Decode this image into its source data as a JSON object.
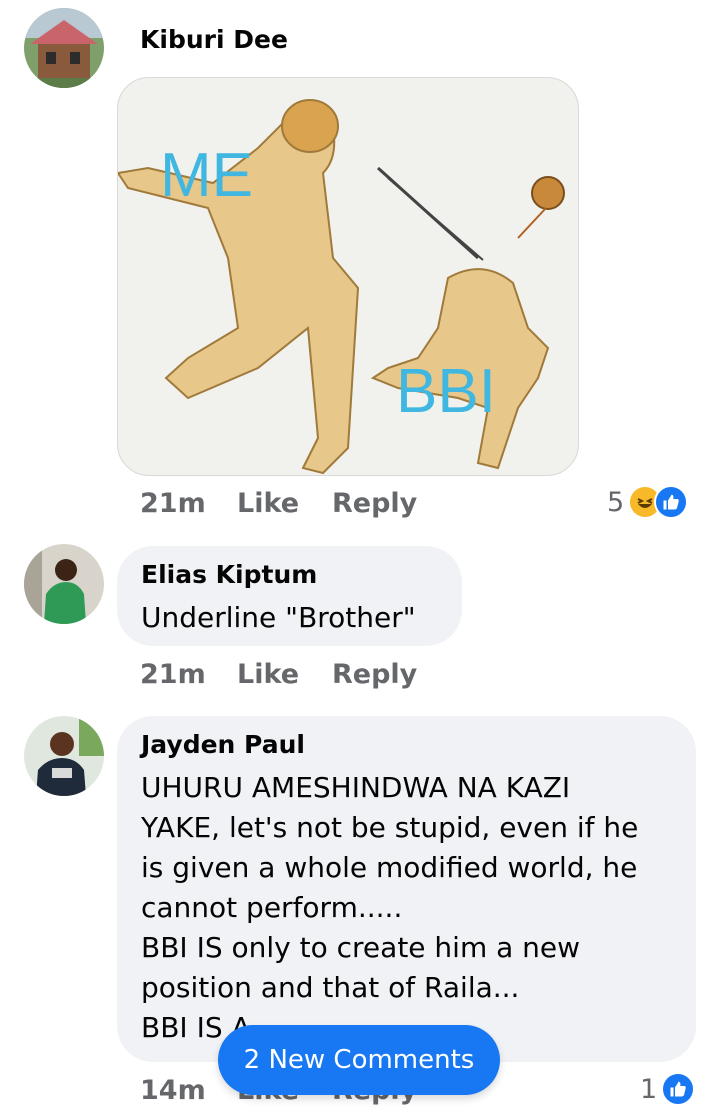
{
  "comments": [
    {
      "author": "Kiburi Dee",
      "image": {
        "caption_top": "ME",
        "caption_bottom": "BBI"
      },
      "time": "21m",
      "like": "Like",
      "reply": "Reply",
      "reaction_count": "5"
    },
    {
      "author": "Elias Kiptum",
      "text": "Underline \"Brother\"",
      "time": "21m",
      "like": "Like",
      "reply": "Reply"
    },
    {
      "author": "Jayden Paul",
      "text": "UHURU AMESHINDWA NA KAZI\nYAKE, let's not be stupid, even if he\nis given a whole modified world, he\ncannot perform.....\nBBI IS only to create him a new\nposition  and that of Raila...\nBBI IS A...",
      "time": "14m",
      "like": "Like",
      "reply": "Reply",
      "reaction_count": "1"
    }
  ],
  "new_comments_label": "2 New Comments",
  "icons": [
    "haha-reaction-icon",
    "like-reaction-icon"
  ],
  "colors": {
    "accent": "#1877f2",
    "bubble": "#f0f2f5",
    "meta": "#65676b"
  }
}
